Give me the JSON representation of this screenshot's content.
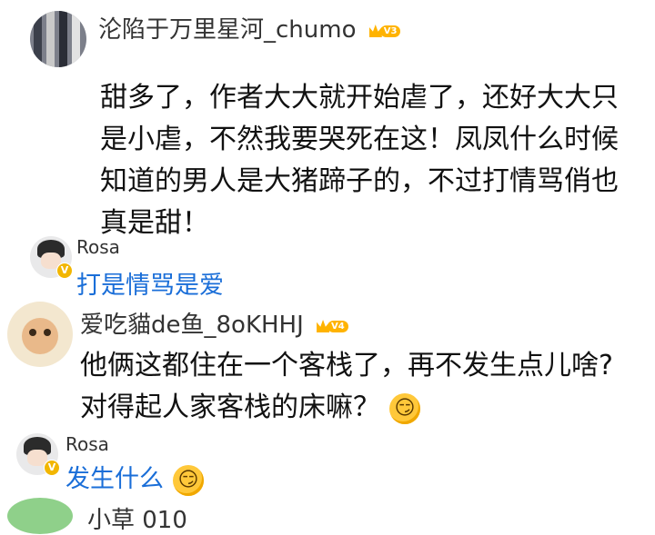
{
  "comments": [
    {
      "username": "沦陷于万里星河_chumo",
      "level": "V3",
      "text": "甜多了，作者大大就开始虐了，还好大大只是小虐，不然我要哭死在这！凤凤什么时候知道的男人是大猪蹄子的，不过打情骂俏也真是甜！"
    },
    {
      "username": "Rosa",
      "verified": "V",
      "text": "打是情骂是爱"
    },
    {
      "username": "爱吃貓de鱼_8oKHHJ",
      "level": "V4",
      "text": "他俩这都住在一个客栈了，再不发生点儿啥?对得起人家客栈的床嘛？",
      "emoji": "smirk-emoji"
    },
    {
      "username": "Rosa",
      "verified": "V",
      "text": "发生什么",
      "emoji": "smirk-emoji"
    }
  ],
  "cutoff_text": "小草 010",
  "colors": {
    "reply_text": "#1a6ed8",
    "badge_gold": "#ffb300"
  }
}
